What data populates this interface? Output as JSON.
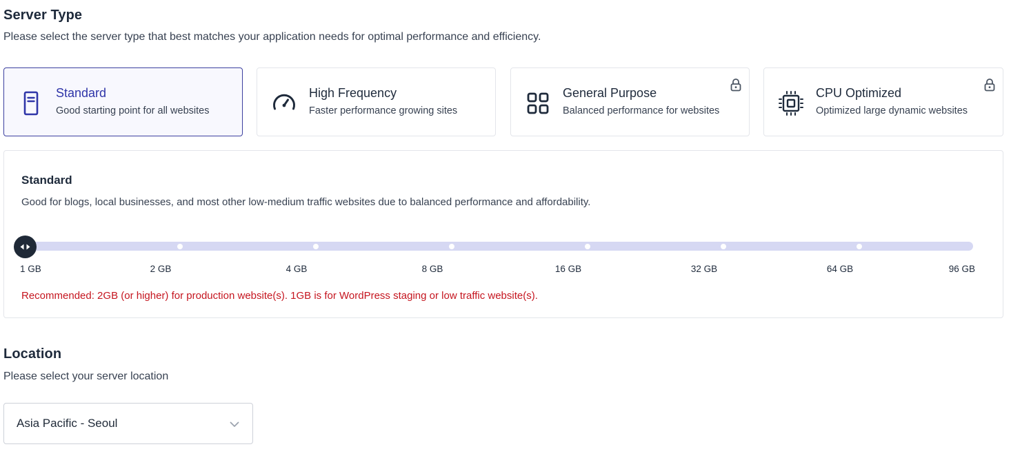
{
  "server_type": {
    "title": "Server Type",
    "subtitle": "Please select the server type that best matches your application needs for optimal performance and efficiency.",
    "cards": [
      {
        "name": "Standard",
        "desc": "Good starting point for all websites",
        "icon": "server-icon",
        "selected": true,
        "locked": false
      },
      {
        "name": "High Frequency",
        "desc": "Faster performance growing sites",
        "icon": "speedometer-icon",
        "selected": false,
        "locked": false
      },
      {
        "name": "General Purpose",
        "desc": "Balanced performance for websites",
        "icon": "grid-icon",
        "selected": false,
        "locked": true
      },
      {
        "name": "CPU Optimized",
        "desc": "Optimized large dynamic websites",
        "icon": "cpu-chip-icon",
        "selected": false,
        "locked": true
      }
    ]
  },
  "detail": {
    "title": "Standard",
    "desc": "Good for blogs, local businesses, and most other low-medium traffic websites due to balanced performance and affordability.",
    "memory_options": [
      "1 GB",
      "2 GB",
      "4 GB",
      "8 GB",
      "16 GB",
      "32 GB",
      "64 GB",
      "96 GB"
    ],
    "selected_memory_index": 0,
    "recommendation": "Recommended: 2GB (or higher) for production website(s). 1GB is for WordPress staging or low traffic website(s)."
  },
  "location": {
    "title": "Location",
    "subtitle": "Please select your server location",
    "selected": "Asia Pacific - Seoul"
  },
  "colors": {
    "accent": "#2f35a8",
    "track": "#d6d8f3",
    "thumb": "#1f2937",
    "warning": "#c5151f"
  }
}
